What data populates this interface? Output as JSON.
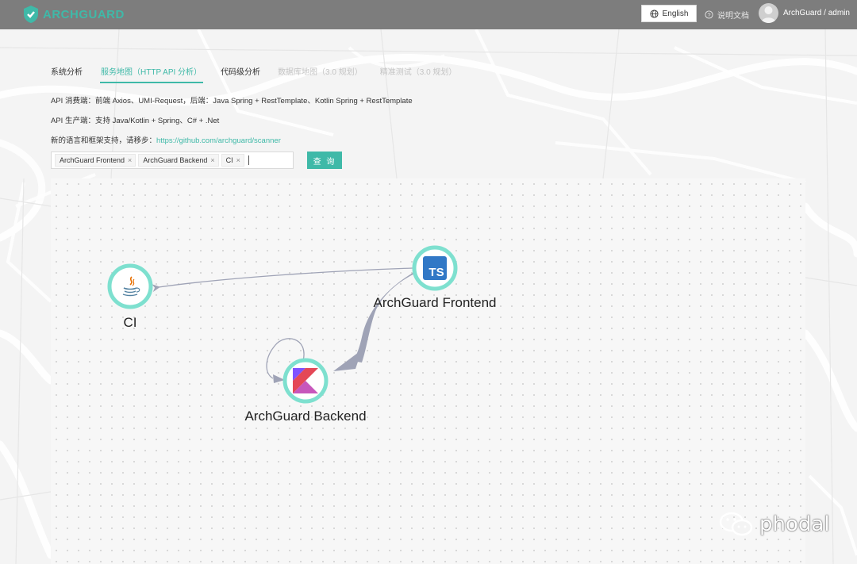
{
  "header": {
    "logo_text": "ARCHGUARD",
    "language_button": "English",
    "docs_link": "说明文档",
    "user_name": "ArchGuard / admin"
  },
  "tabs": [
    {
      "label": "系统分析",
      "state": "normal"
    },
    {
      "label": "服务地图（HTTP API 分析）",
      "state": "active"
    },
    {
      "label": "代码级分析",
      "state": "normal"
    },
    {
      "label": "数据库地图（3.0 规划）",
      "state": "disabled"
    },
    {
      "label": "精准测试（3.0 规划）",
      "state": "disabled"
    }
  ],
  "info": {
    "consumer": "API 消费端：前端 Axios、UMI-Request，后端：Java Spring + RestTemplate、Kotlin Spring + RestTemplate",
    "producer": "API 生产端：支持 Java/Kotlin + Spring、C# + .Net",
    "more_prefix": "新的语言和框架支持，请移步：",
    "more_link": "https://github.com/archguard/scanner"
  },
  "filter": {
    "tags": [
      "ArchGuard Frontend",
      "ArchGuard Backend",
      "CI"
    ],
    "query_button": "查 询"
  },
  "graph": {
    "nodes": [
      {
        "id": "ci",
        "label": "CI",
        "icon": "java-icon"
      },
      {
        "id": "frontend",
        "label": "ArchGuard Frontend",
        "icon": "typescript-icon"
      },
      {
        "id": "backend",
        "label": "ArchGuard Backend",
        "icon": "kotlin-icon"
      }
    ],
    "edges": [
      {
        "from": "ArchGuard Frontend",
        "to": "CI",
        "weight": "thin"
      },
      {
        "from": "ArchGuard Frontend",
        "to": "ArchGuard Backend",
        "weight": "thick"
      },
      {
        "from": "ArchGuard Backend",
        "to": "ArchGuard Backend",
        "weight": "thin"
      }
    ]
  },
  "watermark": "phodal",
  "colors": {
    "accent": "#3fb9a8",
    "node_ring": "#7ee0cf",
    "edge": "#a0a4b8",
    "topbar": "#7d7d7d"
  }
}
